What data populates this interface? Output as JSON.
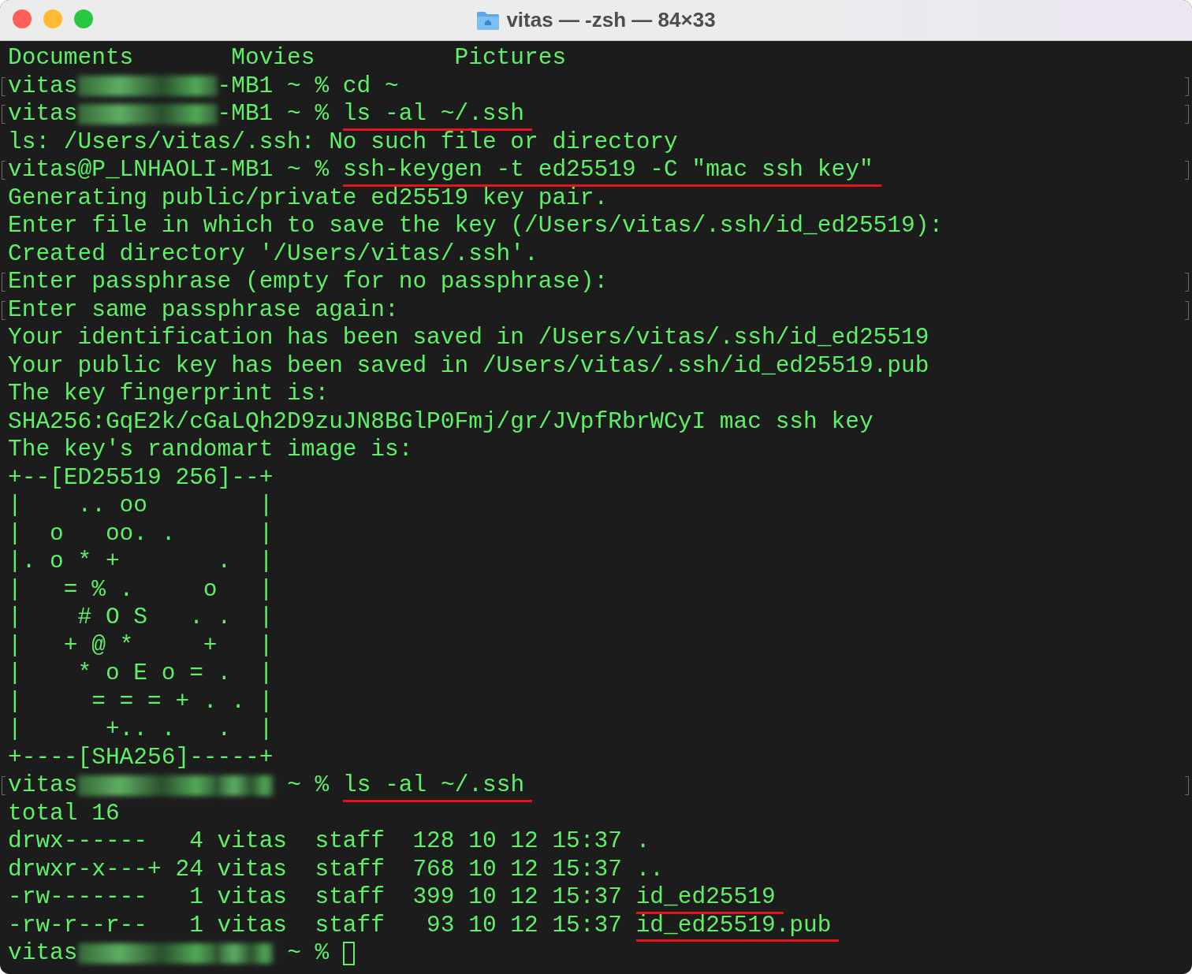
{
  "window": {
    "title": "vitas — -zsh — 84×33"
  },
  "lines": [
    {
      "marked": false,
      "segments": [
        {
          "kind": "text",
          "text": "Documents       Movies          Pictures"
        }
      ]
    },
    {
      "marked": true,
      "segments": [
        {
          "kind": "text",
          "text": "vitas"
        },
        {
          "kind": "redacted"
        },
        {
          "kind": "text",
          "text": "-MB1 ~ % cd ~"
        }
      ]
    },
    {
      "marked": true,
      "segments": [
        {
          "kind": "text",
          "text": "vitas"
        },
        {
          "kind": "redacted"
        },
        {
          "kind": "text",
          "text": "-MB1 ~ % "
        },
        {
          "kind": "underlined",
          "text": "ls -al ~/.ssh"
        }
      ]
    },
    {
      "marked": false,
      "segments": [
        {
          "kind": "text",
          "text": "ls: /Users/vitas/.ssh: No such file or directory"
        }
      ]
    },
    {
      "marked": true,
      "segments": [
        {
          "kind": "text",
          "text": "vitas@P_LNHAOLI-MB1 ~ % "
        },
        {
          "kind": "underlined",
          "text": "ssh-keygen -t ed25519 -C \"mac ssh key\""
        }
      ]
    },
    {
      "marked": false,
      "segments": [
        {
          "kind": "text",
          "text": "Generating public/private ed25519 key pair."
        }
      ]
    },
    {
      "marked": false,
      "segments": [
        {
          "kind": "text",
          "text": "Enter file in which to save the key (/Users/vitas/.ssh/id_ed25519):"
        }
      ]
    },
    {
      "marked": false,
      "segments": [
        {
          "kind": "text",
          "text": "Created directory '/Users/vitas/.ssh'."
        }
      ]
    },
    {
      "marked": true,
      "segments": [
        {
          "kind": "text",
          "text": "Enter passphrase (empty for no passphrase):"
        }
      ]
    },
    {
      "marked": true,
      "segments": [
        {
          "kind": "text",
          "text": "Enter same passphrase again:"
        }
      ]
    },
    {
      "marked": false,
      "segments": [
        {
          "kind": "text",
          "text": "Your identification has been saved in /Users/vitas/.ssh/id_ed25519"
        }
      ]
    },
    {
      "marked": false,
      "segments": [
        {
          "kind": "text",
          "text": "Your public key has been saved in /Users/vitas/.ssh/id_ed25519.pub"
        }
      ]
    },
    {
      "marked": false,
      "segments": [
        {
          "kind": "text",
          "text": "The key fingerprint is:"
        }
      ]
    },
    {
      "marked": false,
      "segments": [
        {
          "kind": "text",
          "text": "SHA256:GqE2k/cGaLQh2D9zuJN8BGlP0Fmj/gr/JVpfRbrWCyI mac ssh key"
        }
      ]
    },
    {
      "marked": false,
      "segments": [
        {
          "kind": "text",
          "text": "The key's randomart image is:"
        }
      ]
    },
    {
      "marked": false,
      "segments": [
        {
          "kind": "text",
          "text": "+--[ED25519 256]--+"
        }
      ]
    },
    {
      "marked": false,
      "segments": [
        {
          "kind": "text",
          "text": "|    .. oo        |"
        }
      ]
    },
    {
      "marked": false,
      "segments": [
        {
          "kind": "text",
          "text": "|  o   oo. .      |"
        }
      ]
    },
    {
      "marked": false,
      "segments": [
        {
          "kind": "text",
          "text": "|. o * +       .  |"
        }
      ]
    },
    {
      "marked": false,
      "segments": [
        {
          "kind": "text",
          "text": "|   = % .     o   |"
        }
      ]
    },
    {
      "marked": false,
      "segments": [
        {
          "kind": "text",
          "text": "|    # O S   . .  |"
        }
      ]
    },
    {
      "marked": false,
      "segments": [
        {
          "kind": "text",
          "text": "|   + @ *     +   |"
        }
      ]
    },
    {
      "marked": false,
      "segments": [
        {
          "kind": "text",
          "text": "|    * o E o = .  |"
        }
      ]
    },
    {
      "marked": false,
      "segments": [
        {
          "kind": "text",
          "text": "|     = = = + . . |"
        }
      ]
    },
    {
      "marked": false,
      "segments": [
        {
          "kind": "text",
          "text": "|      +.. .   .  |"
        }
      ]
    },
    {
      "marked": false,
      "segments": [
        {
          "kind": "text",
          "text": "+----[SHA256]-----+"
        }
      ]
    },
    {
      "marked": true,
      "segments": [
        {
          "kind": "text",
          "text": "vitas"
        },
        {
          "kind": "redacted"
        },
        {
          "kind": "redacted_tail"
        },
        {
          "kind": "text",
          "text": " ~ % "
        },
        {
          "kind": "underlined",
          "text": "ls -al ~/.ssh"
        }
      ]
    },
    {
      "marked": false,
      "segments": [
        {
          "kind": "text",
          "text": "total 16"
        }
      ]
    },
    {
      "marked": false,
      "segments": [
        {
          "kind": "text",
          "text": "drwx------   4 vitas  staff  128 10 12 15:37 ."
        }
      ]
    },
    {
      "marked": false,
      "segments": [
        {
          "kind": "text",
          "text": "drwxr-x---+ 24 vitas  staff  768 10 12 15:37 .."
        }
      ]
    },
    {
      "marked": false,
      "segments": [
        {
          "kind": "text",
          "text": "-rw-------   1 vitas  staff  399 10 12 15:37 "
        },
        {
          "kind": "underlined",
          "text": "id_ed25519"
        }
      ]
    },
    {
      "marked": false,
      "segments": [
        {
          "kind": "text",
          "text": "-rw-r--r--   1 vitas  staff   93 10 12 15:37 "
        },
        {
          "kind": "underlined",
          "text": "id_ed25519.pub"
        }
      ]
    },
    {
      "marked": false,
      "segments": [
        {
          "kind": "text",
          "text": "vitas"
        },
        {
          "kind": "redacted"
        },
        {
          "kind": "redacted_tail"
        },
        {
          "kind": "text",
          "text": " ~ % "
        },
        {
          "kind": "cursor"
        }
      ]
    }
  ]
}
